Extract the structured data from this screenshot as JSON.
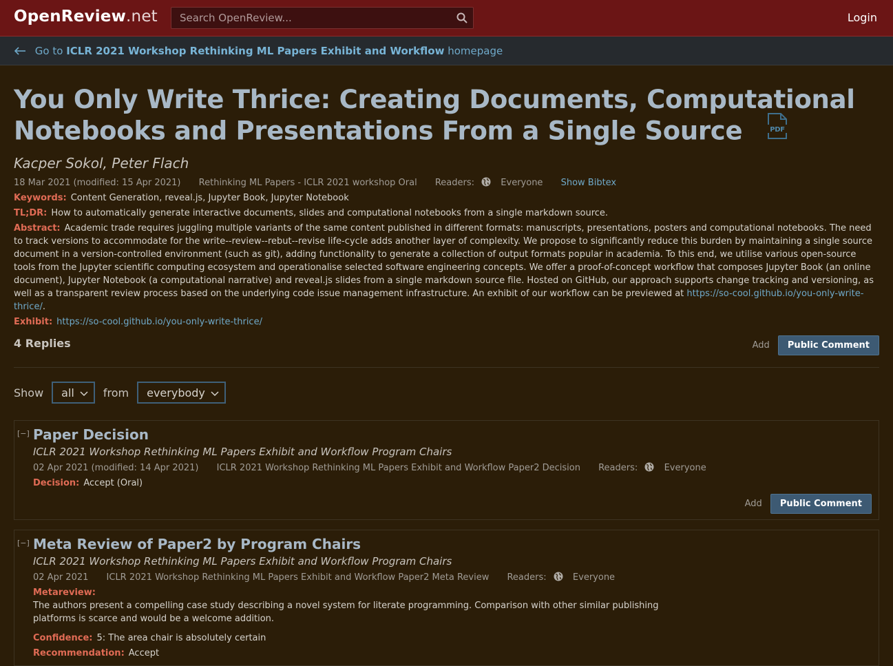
{
  "header": {
    "logo_main": "OpenReview",
    "logo_tld": ".net",
    "search_placeholder": "Search OpenReview...",
    "login": "Login"
  },
  "subbar": {
    "prefix": "Go to",
    "venue": "ICLR 2021 Workshop Rethinking ML Papers Exhibit and Workflow",
    "suffix": "homepage"
  },
  "paper": {
    "title": "You Only Write Thrice: Creating Documents, Computational Notebooks and Presentations From a Single Source",
    "authors": "Kacper Sokol, Peter Flach",
    "date": "18 Mar 2021 (modified: 15 Apr 2021)",
    "venue": "Rethinking ML Papers - ICLR 2021 workshop Oral",
    "readers_label": "Readers:",
    "readers": "Everyone",
    "bibtex": "Show Bibtex",
    "keywords_label": "Keywords:",
    "keywords": "Content Generation, reveal.js, Jupyter Book, Jupyter Notebook",
    "tldr_label": "TL;DR:",
    "tldr": "How to automatically generate interactive documents, slides and computational notebooks from a single markdown source.",
    "abstract_label": "Abstract:",
    "abstract": "Academic trade requires juggling multiple variants of the same content published in different formats: manuscripts, presentations, posters and computational notebooks. The need to track versions to accommodate for the write--review--rebut--revise life-cycle adds another layer of complexity. We propose to significantly reduce this burden by maintaining a single source document in a version-controlled environment (such as git), adding functionality to generate a collection of output formats popular in academia. To this end, we utilise various open-source tools from the Jupyter scientific computing ecosystem and operationalise selected software engineering concepts. We offer a proof-of-concept workflow that composes Jupyter Book (an online document), Jupyter Notebook (a computational narrative) and reveal.js slides from a single markdown source file. Hosted on GitHub, our approach supports change tracking and versioning, as well as a transparent review process based on the underlying code issue management infrastructure. An exhibit of our workflow can be previewed at",
    "abstract_link": "https://so-cool.github.io/you-only-write-thrice/",
    "abstract_end": ".",
    "exhibit_label": "Exhibit:",
    "exhibit_link": "https://so-cool.github.io/you-only-write-thrice/"
  },
  "replies": {
    "count": "4 Replies",
    "add": "Add",
    "public_comment": "Public Comment",
    "show_label": "Show",
    "show_value": "all",
    "from_label": "from",
    "from_value": "everybody"
  },
  "notes": [
    {
      "collapse": "[−]",
      "title": "Paper Decision",
      "signature": "ICLR 2021 Workshop Rethinking ML Papers Exhibit and Workflow Program Chairs",
      "date": "02 Apr 2021 (modified: 14 Apr 2021)",
      "invitation": "ICLR 2021 Workshop Rethinking ML Papers Exhibit and Workflow Paper2 Decision",
      "readers_label": "Readers:",
      "readers": "Everyone",
      "decision_label": "Decision:",
      "decision": "Accept (Oral)",
      "add": "Add",
      "public_comment": "Public Comment"
    },
    {
      "collapse": "[−]",
      "title": "Meta Review of Paper2 by Program Chairs",
      "signature": "ICLR 2021 Workshop Rethinking ML Papers Exhibit and Workflow Program Chairs",
      "date": "02 Apr 2021",
      "invitation": "ICLR 2021 Workshop Rethinking ML Papers Exhibit and Workflow Paper2 Meta Review",
      "readers_label": "Readers:",
      "readers": "Everyone",
      "metareview_label": "Metareview:",
      "metareview": "The authors present a compelling case study describing a novel system for literate programming. Comparison with other similar publishing platforms is scarce and would be a welcome addition.",
      "confidence_label": "Confidence:",
      "confidence": "5: The area chair is absolutely certain",
      "recommendation_label": "Recommendation:",
      "recommendation": "Accept"
    }
  ]
}
